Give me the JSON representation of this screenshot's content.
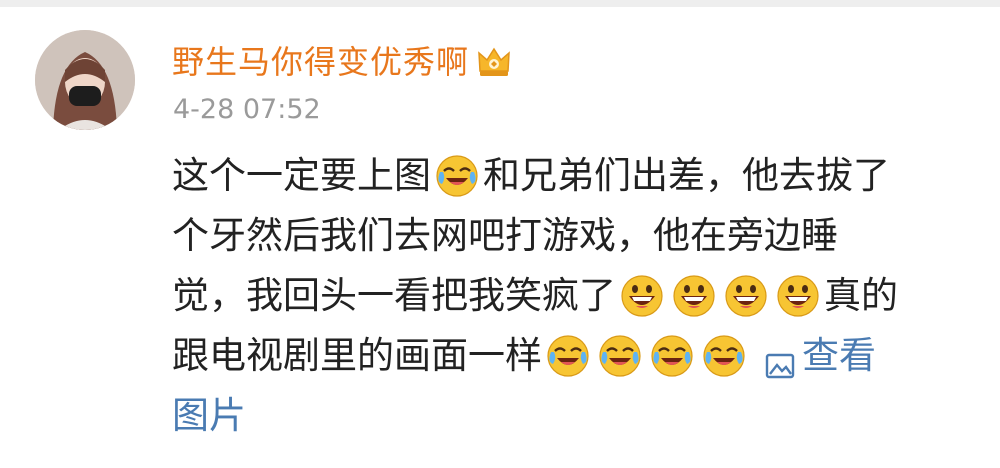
{
  "user": {
    "name": "野生马你得变优秀啊",
    "badge_icon": "crown-vip-icon",
    "avatar_icon": "user-avatar-photo"
  },
  "post": {
    "timestamp": "4-28 07:52"
  },
  "comment": {
    "line1_a": "这个一定要上图",
    "line1_b": "和兄弟们出差，他去拔了",
    "line2": "个牙然后我们去网吧打游戏，他在旁边睡",
    "line3_a": "觉，我回头一看把我笑疯了",
    "line3_b": "真的",
    "line4": "跟电视剧里的画面一样",
    "view_image_label_a": "查看",
    "view_image_label_b": "图片"
  },
  "colors": {
    "username": "#e8771c",
    "timestamp": "#9a9a9a",
    "text": "#222222",
    "link": "#4a7bb2"
  },
  "emojis": {
    "crying_laughing": "laugh-cry-emoji-icon",
    "grinning": "grinning-emoji-icon"
  }
}
